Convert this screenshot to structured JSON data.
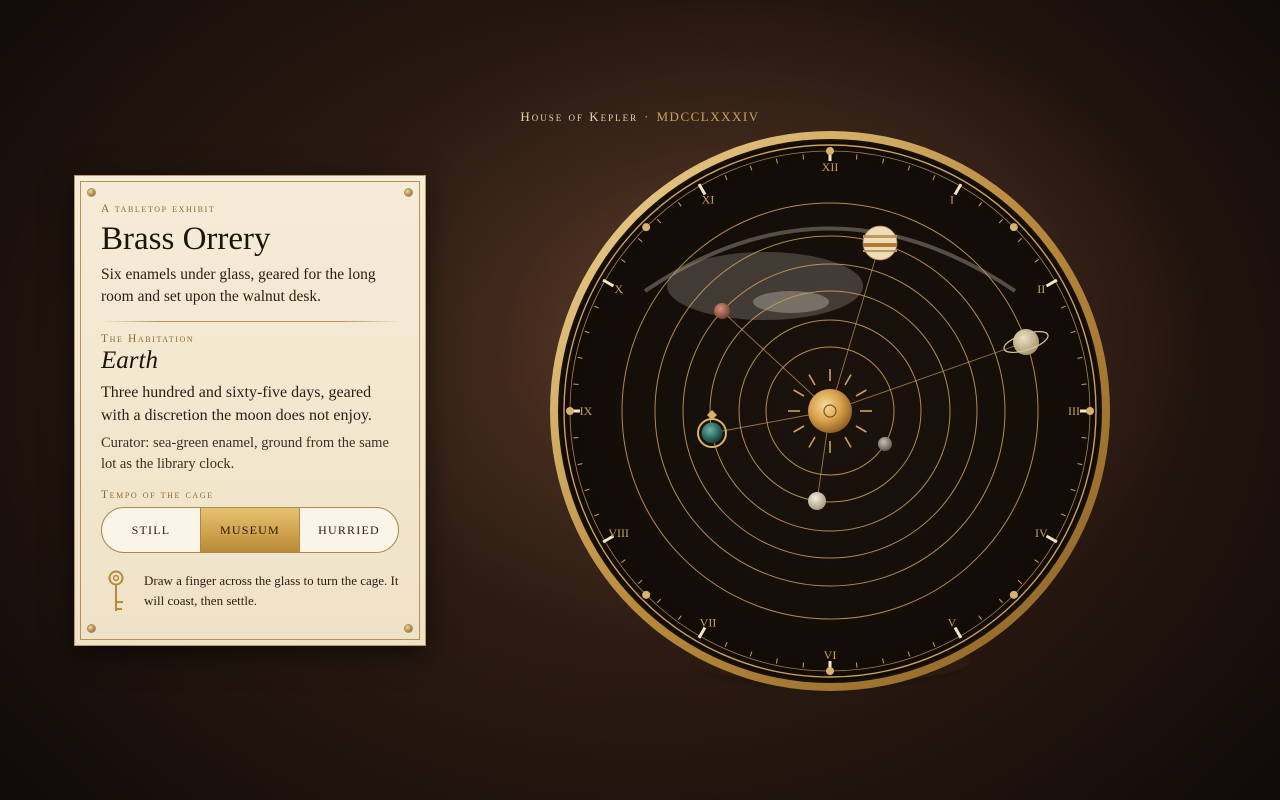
{
  "header": {
    "house": "House of Kepler",
    "separator": "·",
    "year": "MDCCLXXXIV"
  },
  "card": {
    "kicker": "A tabletop exhibit",
    "title": "Brass Orrery",
    "lede": "Six enamels under glass, geared for the long room and set upon the walnut desk.",
    "habitation_label": "The Habitation",
    "planet": "Earth",
    "description": "Three hundred and sixty-five days, geared with a discretion the moon does not enjoy.",
    "curator": "Curator: sea-green enamel, ground from the same lot as the library clock.",
    "tempo_label": "Tempo of the cage",
    "tempo_options": [
      "STILL",
      "MUSEUM",
      "HURRIED"
    ],
    "tempo_selected": "MUSEUM",
    "hint": "Draw a finger across the glass to turn the cage. It will coast, then settle.",
    "hint_icon": "key-icon"
  },
  "dial": {
    "numerals": [
      "XII",
      "I",
      "II",
      "III",
      "IV",
      "V",
      "VI",
      "VII",
      "VIII",
      "IX",
      "X",
      "XI"
    ]
  },
  "colors": {
    "brass": "#c9a25c",
    "brass_light": "#e6c272",
    "dial_face": "#17100b",
    "card_paper": "#f3e8d0",
    "earth_enamel": "#2f6e66"
  }
}
